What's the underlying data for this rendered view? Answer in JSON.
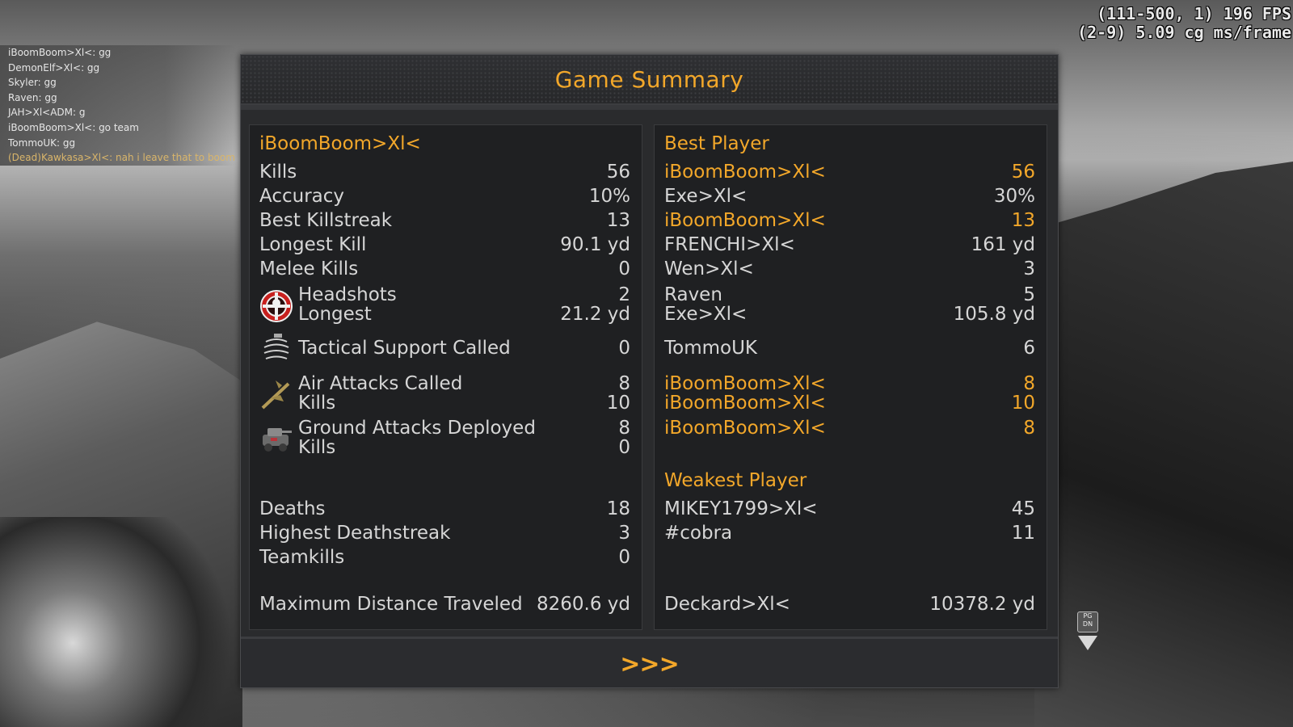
{
  "fps_overlay": {
    "line1": "(111-500, 1) 196 FPS",
    "line2": "(2-9) 5.09 cg ms/frame"
  },
  "chat": [
    {
      "text": "iBoomBoom>Xl<: gg",
      "dead": false
    },
    {
      "text": "DemonElf>Xl<: gg",
      "dead": false
    },
    {
      "text": "Skyler: gg",
      "dead": false
    },
    {
      "text": "Raven: gg",
      "dead": false
    },
    {
      "text": "JAH>Xl<ADM: g",
      "dead": false
    },
    {
      "text": "iBoomBoom>Xl<: go team",
      "dead": false
    },
    {
      "text": "TommoUK: gg",
      "dead": false
    },
    {
      "text": "(Dead)Kawkasa>Xl<: nah i leave that to boom",
      "dead": true
    }
  ],
  "summary": {
    "title": "Game Summary",
    "player_name": "iBoomBoom>Xl<",
    "best_player_heading": "Best Player",
    "weakest_player_heading": "Weakest Player",
    "next_label": ">>>",
    "stats": {
      "kills": {
        "label": "Kills",
        "value": "56",
        "best": "iBoomBoom>Xl<",
        "best_value": "56",
        "best_highlight": true
      },
      "accuracy": {
        "label": "Accuracy",
        "value": "10%",
        "best": "Exe>Xl<",
        "best_value": "30%",
        "best_highlight": false
      },
      "killstreak": {
        "label": "Best Killstreak",
        "value": "13",
        "best": "iBoomBoom>Xl<",
        "best_value": "13",
        "best_highlight": true
      },
      "longest_kill": {
        "label": "Longest Kill",
        "value": "90.1 yd",
        "best": "FRENCHI>Xl<",
        "best_value": "161 yd",
        "best_highlight": false
      },
      "melee": {
        "label": "Melee Kills",
        "value": "0",
        "best": "Wen>Xl<",
        "best_value": "3",
        "best_highlight": false
      },
      "headshots": {
        "label": "Headshots",
        "value": "2",
        "best": "Raven",
        "best_value": "5",
        "best_highlight": false
      },
      "headshot_longest": {
        "label": "Longest",
        "value": "21.2 yd",
        "best": "Exe>Xl<",
        "best_value": "105.8 yd",
        "best_highlight": false
      },
      "tactical": {
        "label": "Tactical Support Called",
        "value": "0",
        "best": "TommoUK",
        "best_value": "6",
        "best_highlight": false
      },
      "air_called": {
        "label": "Air Attacks Called",
        "value": "8",
        "best": "iBoomBoom>Xl<",
        "best_value": "8",
        "best_highlight": true
      },
      "air_kills": {
        "label": "Kills",
        "value": "10",
        "best": "iBoomBoom>Xl<",
        "best_value": "10",
        "best_highlight": true
      },
      "ground_deployed": {
        "label": "Ground Attacks Deployed",
        "value": "8",
        "best": "iBoomBoom>Xl<",
        "best_value": "8",
        "best_highlight": true
      },
      "ground_kills": {
        "label": "Kills",
        "value": "0",
        "best": "",
        "best_value": "",
        "best_highlight": false
      },
      "deaths": {
        "label": "Deaths",
        "value": "18",
        "best": "MIKEY1799>Xl<",
        "best_value": "45",
        "best_highlight": false
      },
      "deathstreak": {
        "label": "Highest Deathstreak",
        "value": "3",
        "best": "#cobra",
        "best_value": "11",
        "best_highlight": false
      },
      "teamkills": {
        "label": "Teamkills",
        "value": "0",
        "best": "",
        "best_value": "",
        "best_highlight": false
      },
      "distance": {
        "label": "Maximum Distance Traveled",
        "value": "8260.6 yd",
        "best": "Deckard>Xl<",
        "best_value": "10378.2 yd",
        "best_highlight": false
      }
    },
    "icons": [
      "headshot-icon",
      "tactical-support-icon",
      "air-attack-icon",
      "ground-attack-icon"
    ]
  },
  "hint": {
    "pgdn_label": "PG DN"
  },
  "colors": {
    "accent": "#f2a72a",
    "panel": "#2a2b2d",
    "column": "#1f2022",
    "text": "#d6d6d6"
  }
}
